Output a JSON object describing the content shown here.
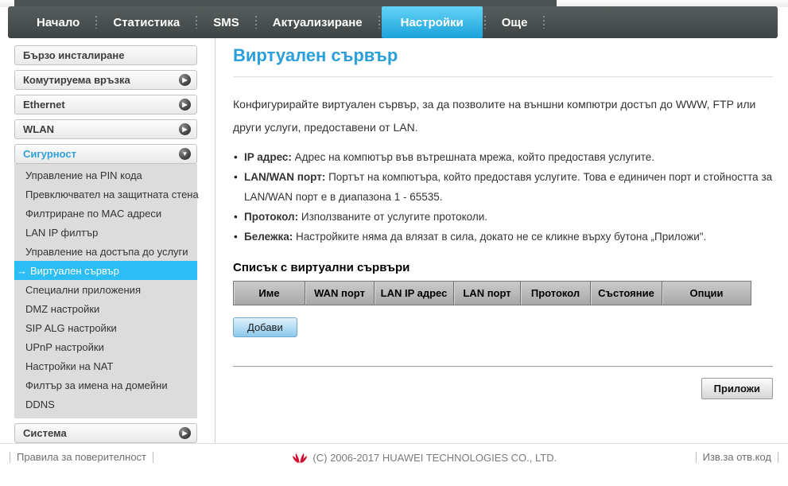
{
  "nav": {
    "items": [
      {
        "label": "Начало",
        "active": false
      },
      {
        "label": "Статистика",
        "active": false
      },
      {
        "label": "SMS",
        "active": false
      },
      {
        "label": "Актуализиране",
        "active": false
      },
      {
        "label": "Настройки",
        "active": true
      },
      {
        "label": "Още",
        "active": false
      }
    ]
  },
  "sidebar": {
    "sections": [
      {
        "label": "Бързо инсталиране",
        "arrow": "none"
      },
      {
        "label": "Комутируема връзка",
        "arrow": "right"
      },
      {
        "label": "Ethernet",
        "arrow": "right"
      },
      {
        "label": "WLAN",
        "arrow": "right"
      },
      {
        "label": "Сигурност",
        "arrow": "down"
      },
      {
        "label": "Система",
        "arrow": "right"
      }
    ],
    "arrow_right": "▶",
    "arrow_down": "▼",
    "selected_prefix": "→",
    "security_items": [
      {
        "label": "Управление на PIN кода",
        "selected": false
      },
      {
        "label": "Превключвател на защитната стена",
        "selected": false
      },
      {
        "label": "Филтриране по MAC адреси",
        "selected": false
      },
      {
        "label": "LAN IP филтър",
        "selected": false
      },
      {
        "label": "Управление на достъпа до услуги",
        "selected": false
      },
      {
        "label": "Виртуален сървър",
        "selected": true
      },
      {
        "label": "Специални приложения",
        "selected": false
      },
      {
        "label": "DMZ настройки",
        "selected": false
      },
      {
        "label": "SIP ALG настройки",
        "selected": false
      },
      {
        "label": "UPnP настройки",
        "selected": false
      },
      {
        "label": "Настройки на NAT",
        "selected": false
      },
      {
        "label": "Филтър за имена на домейни",
        "selected": false
      },
      {
        "label": "DDNS",
        "selected": false
      }
    ]
  },
  "main": {
    "title": "Виртуален сървър",
    "intro": "Конфигурирайте виртуален сървър, за да позволите на външни компютри достъп до WWW, FTP или други услуги, предоставени от LAN.",
    "bullets": [
      {
        "lead": "IP адрес:",
        "text": " Адрес на компютър във вътрешната мрежа, който предоставя услугите."
      },
      {
        "lead": "LAN/WAN порт:",
        "text": " Портът на компютъра, който предоставя услугите. Това е единичен порт и стойността за LAN/WAN порт е в диапазона 1 - 65535."
      },
      {
        "lead": "Протокол:",
        "text": " Използваните от услугите протоколи."
      },
      {
        "lead": "Бележка:",
        "text": " Настройките няма да влязат в сила, докато не се кликне върху бутона „Приложи\"."
      }
    ],
    "list_heading": "Списък с виртуални сървъри",
    "table": {
      "headers": [
        "Име",
        "WAN порт",
        "LAN IP адрес",
        "LAN порт",
        "Протокол",
        "Състояние",
        "Опции"
      ],
      "rows": []
    },
    "add_button": "Добави",
    "apply_button": "Приложи"
  },
  "footer": {
    "privacy": "Правила за поверителност",
    "copyright": "(C) 2006-2017 HUAWEI TECHNOLOGIES CO., LTD.",
    "open_source": "Изв.за отв.код"
  },
  "colors": {
    "accent": "#2b9fd9",
    "nav_bg": "#4a5150",
    "active_tab": "#2db3e8",
    "selected_item_bg": "#2bbdf4",
    "huawei_red": "#cf0a2c"
  }
}
